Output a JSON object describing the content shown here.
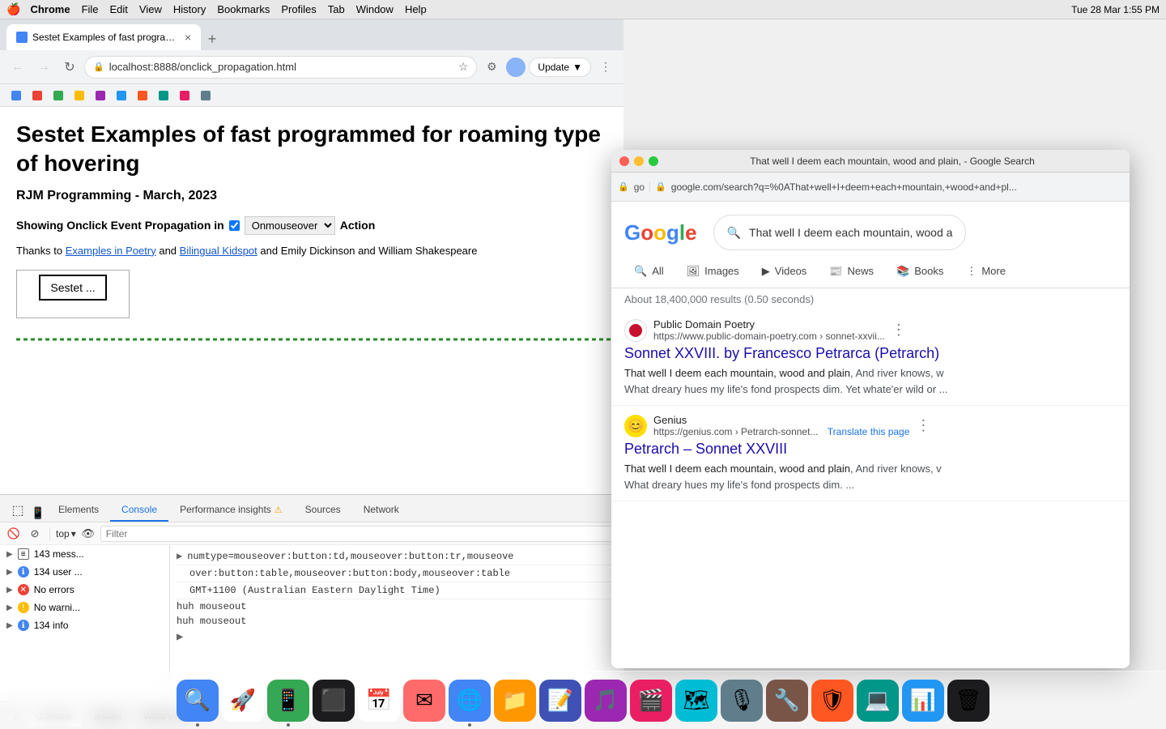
{
  "mac_menubar": {
    "apple": "🍎",
    "items": [
      "Chrome",
      "File",
      "Edit",
      "View",
      "History",
      "Bookmarks",
      "Profiles",
      "Tab",
      "Window",
      "Help"
    ],
    "time": "Tue 28 Mar  1:55 PM"
  },
  "browser": {
    "tab_title": "Sestet Examples of fast programmed...",
    "url": "localhost:8888/onclick_propagation.html",
    "update_btn": "Update"
  },
  "page": {
    "title": "Sestet Examples of fast programmed for roaming type of hovering",
    "subtitle": "RJM Programming - March, 2023",
    "showing_label": "Showing Onclick Event Propagation in",
    "dropdown_value": "Onmouseover",
    "action_label": "Action",
    "thanks_prefix": "Thanks to",
    "thanks_link1": "Examples in Poetry",
    "thanks_and": "and",
    "thanks_link2": "Bilingual Kidspot",
    "thanks_suffix": "and Emily Dickinson and William Shakespeare",
    "sestet_btn": "Sestet ..."
  },
  "devtools": {
    "tabs": [
      "Elements",
      "Console",
      "Performance insights",
      "Sources",
      "Network"
    ],
    "active_tab": "Console",
    "toolbar": {
      "top_label": "top",
      "filter_placeholder": "Filter"
    },
    "sidebar_items": [
      {
        "icon": "list",
        "text": "143 mess..."
      },
      {
        "icon": "circle-blue",
        "text": "134 user ..."
      },
      {
        "icon": "circle-red",
        "text": "No errors"
      },
      {
        "icon": "circle-yellow",
        "text": "No warni..."
      },
      {
        "icon": "circle-info",
        "text": "134 info"
      }
    ],
    "console_lines": [
      "numtype=mouseover:button:td,mouseover:button:tr,mouseove",
      "over:button:table,mouseover:button:body,mouseover:table",
      "GMT+1100 (Australian Eastern Daylight Time)"
    ],
    "huh_lines": [
      "huh mouseout",
      "huh mouseout"
    ],
    "bottom_tabs": [
      "Console",
      "Issues",
      "What's New"
    ]
  },
  "google_window": {
    "title": "That well I deem each mountain, wood and plain, - Google Search",
    "url": "google.com/search?q=%0AThat+well+I+deem+each+mountain,+wood+and+pl...",
    "search_query": "That well I deem each mountain, wood a",
    "tabs": [
      "All",
      "Images",
      "Videos",
      "News",
      "Books",
      "More"
    ],
    "active_tab": "All",
    "results_count": "About 18,400,000 results (0.50 seconds)",
    "results": [
      {
        "site": "Public Domain Poetry",
        "url": "https://www.public-domain-poetry.com › sonnet-xxvii...",
        "title": "Sonnet XXVIII. by Francesco Petrarca (Petrarch)",
        "snippet_bold": "That well I deem each mountain, wood and plain",
        "snippet_rest": ", And river knows, w",
        "snippet2": "What dreary hues my life's fond prospects dim. Yet whate'er wild or ..."
      },
      {
        "site": "Genius",
        "url": "https://genius.com › Petrarch-sonnet...",
        "translate": "Translate this page",
        "title": "Petrarch – Sonnet XXVIII",
        "snippet_bold": "That well I deem each mountain, wood and plain",
        "snippet_rest": ", And river knows, v",
        "snippet2": "What dreary hues my life's fond prospects dim. ..."
      }
    ]
  }
}
